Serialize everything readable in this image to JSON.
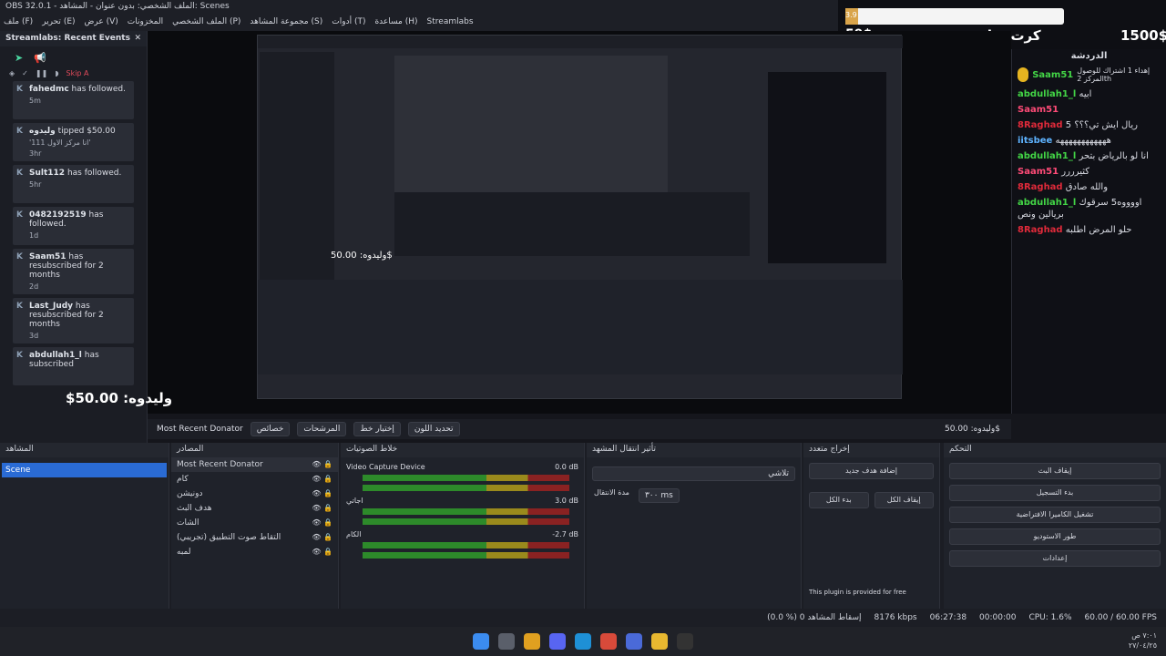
{
  "window": {
    "title": "OBS 32.0.1 - الملف الشخصي: بدون عنوان - المشاهد: Scenes"
  },
  "menu": [
    "ملف (F)",
    "تحرير (E)",
    "عرض (V)",
    "المخزونات",
    "الملف الشخصي (P)",
    "مجموعة المشاهد (S)",
    "أدوات (T)",
    "مساعدة (H)",
    "Streamlabs"
  ],
  "overlay": {
    "goal_small": "3.9",
    "goal_left": "59$",
    "title": "كرت شاشه",
    "goal_right": "1500$"
  },
  "events": {
    "title": "Streamlabs: Recent Events",
    "skip": "Skip A",
    "items": [
      {
        "name": "fahedmc",
        "action": "has followed.",
        "time": "5m"
      },
      {
        "name": "وليدوه",
        "action": "tipped $50.00",
        "note": "'انا مركز الاول 111'",
        "time": "3hr"
      },
      {
        "name": "Sult112",
        "action": "has followed.",
        "time": "5hr"
      },
      {
        "name": "0482192519",
        "action": "has followed.",
        "time": "1d"
      },
      {
        "name": "Saam51",
        "action": "has resubscribed for 2 months",
        "time": "2d"
      },
      {
        "name": "Last_Judy",
        "action": "has resubscribed for 2 months",
        "time": "3d"
      },
      {
        "name": "abdullah1_l",
        "action": "has subscribed",
        "time": ""
      }
    ]
  },
  "preview": {
    "donator": "وليدوه: 50.00$"
  },
  "chat": {
    "header": "الدردشة",
    "pinned_user": "Saam51",
    "pinned_text": "إهداء 1 اشتراك للوصول المركز 2th",
    "lines": [
      {
        "user": "abdullah1_l",
        "cls": "u-green",
        "text": "ابيه"
      },
      {
        "user": "Saam51",
        "cls": "u-pink",
        "text": ""
      },
      {
        "user": "8Raghad",
        "cls": "u-red",
        "text": "ريال ايش تي؟؟؟ 5"
      },
      {
        "user": "iitsbee",
        "cls": "u-blue",
        "text": "ههههههههههههه"
      },
      {
        "user": "abdullah1_l",
        "cls": "u-green",
        "text": "انا لو بالرياض بتحر"
      },
      {
        "user": "Saam51",
        "cls": "u-pink",
        "text": "كثيرررر"
      },
      {
        "user": "8Raghad",
        "cls": "u-red",
        "text": "والله صادق"
      },
      {
        "user": "abdullah1_l",
        "cls": "u-green",
        "text": "اووووه5 سرقوك بريالين ونص"
      },
      {
        "user": "8Raghad",
        "cls": "u-red",
        "text": "حلو المرض اطلبه"
      }
    ]
  },
  "source_bar": {
    "source": "Most Recent Donator",
    "props": "خصائص",
    "filters": "المرشحات",
    "select": "إختيار خط",
    "color": "تحديد اللون",
    "value": "وليدوه: 50.00$"
  },
  "docks": {
    "scenes": {
      "title": "المشاهد",
      "items": [
        "Scene"
      ]
    },
    "sources": {
      "title": "المصادر",
      "items": [
        "Most Recent Donator",
        "كام",
        "دونيشن",
        "هدف البث",
        "الشات",
        "التقاط صوت التطبيق (تجريبي)",
        "لمبه"
      ]
    },
    "mixer": {
      "title": "خلاط الصوتيات",
      "channels": [
        {
          "name": "Video Capture Device",
          "db": "0.0 dB"
        },
        {
          "name": "اجاتي",
          "db": "3.0 dB"
        },
        {
          "name": "الكام",
          "db": "-2.7 dB"
        }
      ]
    },
    "transitions": {
      "title": "تأثير انتقال المشهد",
      "type": "تلاشي",
      "duration_label": "مدة الانتقال",
      "duration": "٣٠٠ ms"
    },
    "multi": {
      "title": "إخراج متعدد",
      "add": "إضافة هدف جديد",
      "start_all": "بدء الكل",
      "stop_all": "إيقاف الكل",
      "footer": "This plugin is provided for free"
    },
    "controls": {
      "title": "التحكم",
      "buttons": [
        "إيقاف البث",
        "بدء التسجيل",
        "تشغيل الكاميرا الافتراضية",
        "طور الاستوديو",
        "إعدادات"
      ]
    }
  },
  "status": {
    "frames": "(0.0 %) إسقاط المشاهد 0",
    "bitrate": "8176 kbps",
    "stream_time": "06:27:38",
    "rec_time": "00:00:00",
    "cpu": "CPU: 1.6%",
    "fps": "60.00 / 60.00 FPS"
  },
  "tray": {
    "time": "٧:٠١ ص",
    "date": "٢٧/٠٤/٢٥"
  }
}
